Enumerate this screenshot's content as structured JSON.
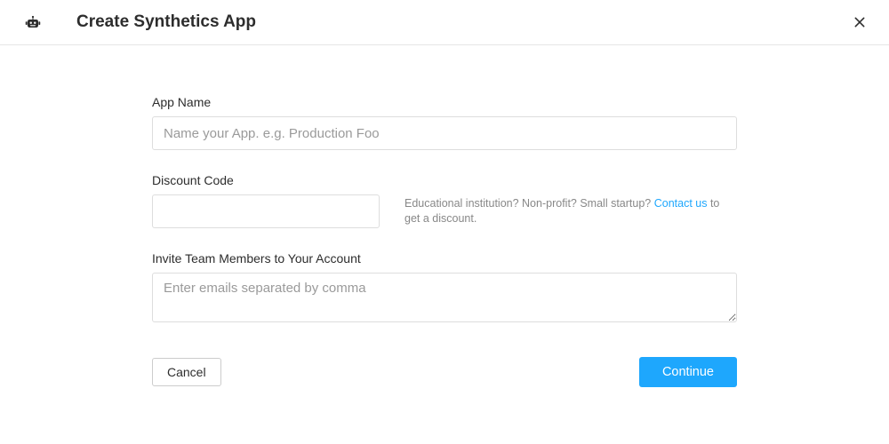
{
  "header": {
    "title": "Create Synthetics App"
  },
  "form": {
    "app_name": {
      "label": "App Name",
      "placeholder": "Name your App. e.g. Production Foo",
      "value": ""
    },
    "discount_code": {
      "label": "Discount Code",
      "value": "",
      "help_prefix": "Educational institution? Non-profit? Small startup? ",
      "help_link": "Contact us",
      "help_suffix": " to get a discount."
    },
    "invite": {
      "label": "Invite Team Members to Your Account",
      "placeholder": "Enter emails separated by comma",
      "value": ""
    }
  },
  "buttons": {
    "cancel": "Cancel",
    "continue": "Continue"
  }
}
